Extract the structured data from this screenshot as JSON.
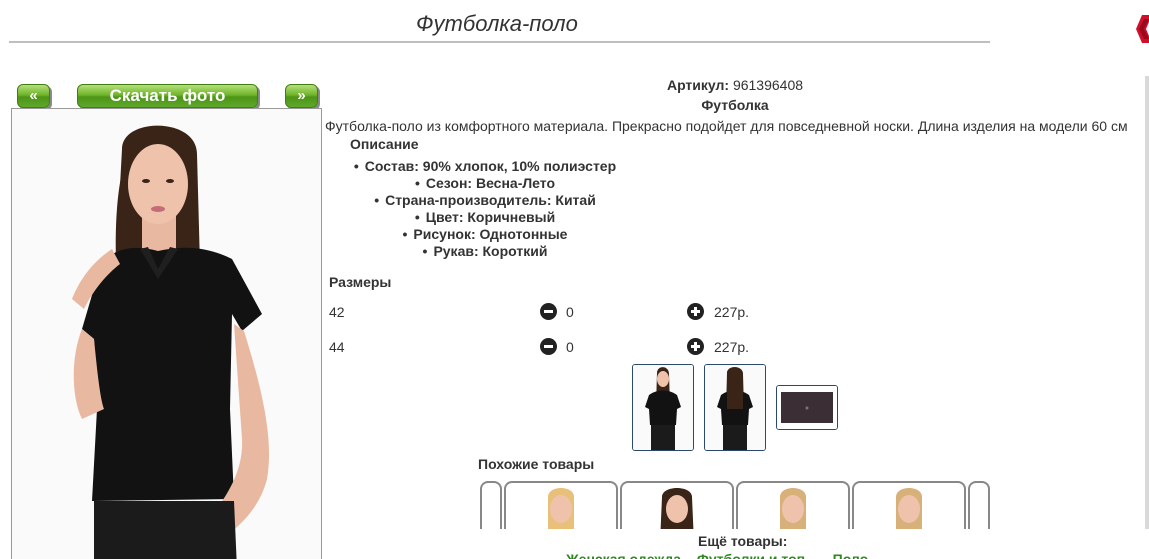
{
  "product": {
    "title": "Футболка-поло",
    "sku_label": "Артикул:",
    "sku_value": "961396408",
    "category": "Футболка",
    "description": "Футболка-поло из комфортного материала. Прекрасно подойдет для повседневной носки. Длина изделия на модели 60 см",
    "description_heading": "Описание",
    "specs": [
      "Состав: 90% хлопок, 10% полиэстер",
      "Сезон: Весна-Лето",
      "Страна-производитель: Китай",
      "Цвет: Коричневый",
      "Рисунок: Однотонные",
      "Рукав: Короткий"
    ]
  },
  "gallery": {
    "prev_label": "«",
    "download_label": "Скачать фото",
    "next_label": "»",
    "thumbnails": [
      "front-view",
      "back-view",
      "fabric-detail"
    ]
  },
  "sizes": {
    "heading": "Размеры",
    "rows": [
      {
        "size": "42",
        "qty": "0",
        "price": "227р."
      },
      {
        "size": "44",
        "qty": "0",
        "price": "227р."
      }
    ]
  },
  "similar": {
    "heading": "Похожие товары"
  },
  "more": {
    "heading": "Ещё товары:",
    "links": [
      "Женская одежда",
      "Футболки и топ...",
      "Поло"
    ]
  },
  "colors": {
    "accent_green": "#5fa82a",
    "close_red": "#d0102a",
    "thumb_border": "#2b4a6b"
  },
  "icons": {
    "close": "close-icon",
    "minus": "minus-circle-icon",
    "plus": "plus-circle-icon"
  }
}
